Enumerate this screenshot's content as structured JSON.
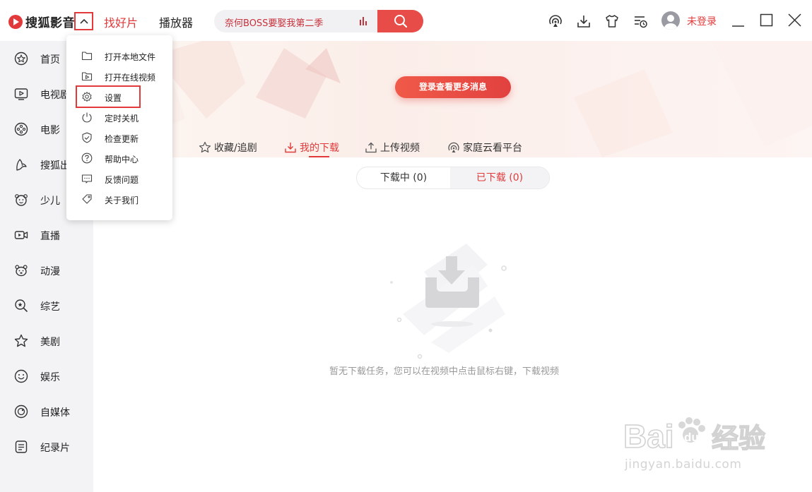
{
  "app": {
    "name": "搜狐影音"
  },
  "header": {
    "nav": [
      {
        "label": "找好片",
        "active": true
      },
      {
        "label": "播放器",
        "active": false
      }
    ],
    "search": {
      "value": "奈何BOSS要娶我第二季"
    },
    "toolbar_icons": [
      "cast-icon",
      "download-icon",
      "skin-icon",
      "history-icon"
    ],
    "login_label": "未登录",
    "window_controls": [
      "minimize-icon",
      "maximize-icon",
      "close-icon"
    ]
  },
  "sidebar": {
    "items": [
      {
        "label": "首页",
        "icon": "home-icon"
      },
      {
        "label": "电视剧",
        "icon": "tv-icon"
      },
      {
        "label": "电影",
        "icon": "film-reel-icon"
      },
      {
        "label": "搜狐出品",
        "icon": "fox-icon"
      },
      {
        "label": "少儿",
        "icon": "kid-icon"
      },
      {
        "label": "直播",
        "icon": "live-camera-icon"
      },
      {
        "label": "动漫",
        "icon": "bear-icon"
      },
      {
        "label": "综艺",
        "icon": "magnifier-star-icon"
      },
      {
        "label": "美剧",
        "icon": "star-icon"
      },
      {
        "label": "娱乐",
        "icon": "smile-icon"
      },
      {
        "label": "自媒体",
        "icon": "record-icon"
      },
      {
        "label": "纪录片",
        "icon": "document-icon"
      }
    ]
  },
  "dropdown": {
    "items": [
      {
        "label": "打开本地文件",
        "icon": "folder-icon"
      },
      {
        "label": "打开在线视频",
        "icon": "play-folder-icon"
      },
      {
        "label": "设置",
        "icon": "gear-icon",
        "highlighted": true
      },
      {
        "label": "定时关机",
        "icon": "power-icon"
      },
      {
        "label": "检查更新",
        "icon": "shield-check-icon"
      },
      {
        "label": "帮助中心",
        "icon": "help-icon"
      },
      {
        "label": "反馈问题",
        "icon": "feedback-icon"
      },
      {
        "label": "关于我们",
        "icon": "tag-icon"
      }
    ]
  },
  "main": {
    "banner_button": "登录查看更多消息",
    "tabs": [
      {
        "label": "收藏/追剧",
        "icon": "star-outline-icon",
        "active": false
      },
      {
        "label": "我的下载",
        "icon": "download-tab-icon",
        "active": true
      },
      {
        "label": "上传视频",
        "icon": "upload-icon",
        "active": false
      },
      {
        "label": "家庭云看平台",
        "icon": "cast-tab-icon",
        "active": false
      }
    ],
    "download_toggle": {
      "downloading": "下载中 (0)",
      "downloaded": "已下载 (0)",
      "selected": "downloaded"
    },
    "empty_message": "暂无下载任务，您可以在视频中点击鼠标右键，下载视频"
  },
  "watermark": {
    "brand": "Bai经验",
    "url": "jingyan.baidu.com"
  },
  "colors": {
    "accent": "#e23a3a",
    "sidebar_bg": "#f3f3f5",
    "search_bg": "#f1f1f3"
  }
}
